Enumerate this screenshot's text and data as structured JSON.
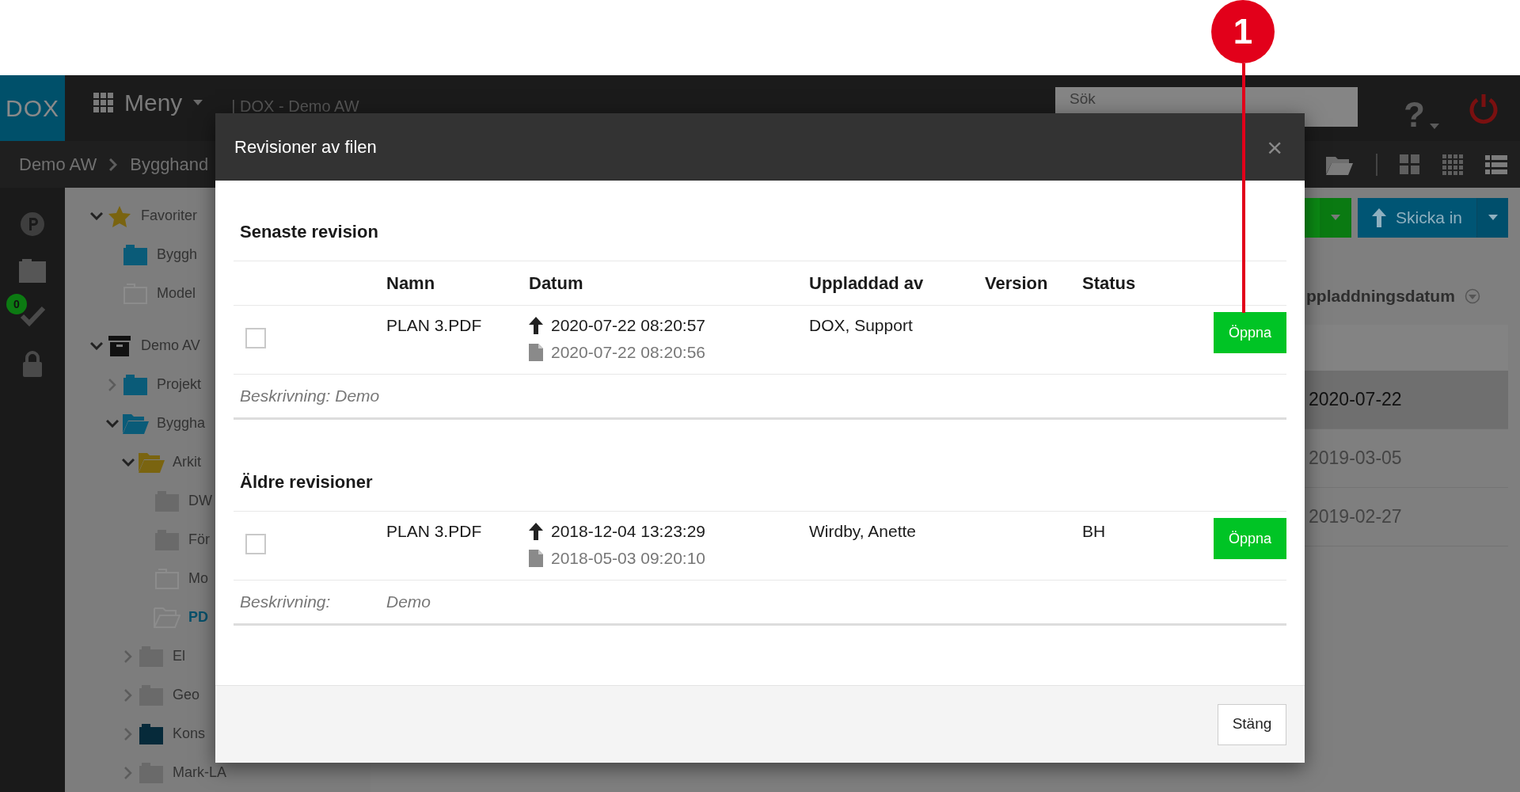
{
  "callout": {
    "number": "1"
  },
  "topbar": {
    "help": "?",
    "logo": "DOX",
    "menu": "Meny",
    "title": "| DOX - Demo AW",
    "search": {
      "placeholder": "Sök"
    }
  },
  "breadcrumb": [
    "Demo AW",
    "Bygghand"
  ],
  "rail": {
    "badge": "0"
  },
  "tree": [
    {
      "label": "Favoriter",
      "kind": "star",
      "color": "#7a6410",
      "expanded": true,
      "selected": false,
      "children": [
        {
          "label": "Byggh",
          "kind": "folder",
          "color": "#0a5b78",
          "selected": false
        },
        {
          "label": "Model",
          "kind": "folder-outline",
          "color": "#8c8c8c",
          "selected": false
        }
      ]
    },
    {
      "label": "Demo AV",
      "kind": "archive",
      "color": "#111111",
      "expanded": true,
      "selected": false,
      "children": [
        {
          "label": "Projekt",
          "kind": "folder",
          "color": "#0a5b78",
          "expanded": false,
          "selected": false
        },
        {
          "label": "Byggha",
          "kind": "folder-open",
          "color": "#0a5b78",
          "expanded": true,
          "selected": false,
          "children": [
            {
              "label": "Arkit",
              "kind": "folder-open",
              "color": "#7a6410",
              "expanded": true,
              "selected": false,
              "children": [
                {
                  "label": "DW",
                  "kind": "folder",
                  "color": "#6a6a6a",
                  "selected": false
                },
                {
                  "label": "För",
                  "kind": "folder",
                  "color": "#6a6a6a",
                  "selected": false
                },
                {
                  "label": "Mo",
                  "kind": "folder-outline",
                  "color": "#8c8c8c",
                  "selected": false
                },
                {
                  "label": "PD",
                  "kind": "folder-open-outline",
                  "color": "#8c8c8c",
                  "selected": true
                }
              ]
            },
            {
              "label": "El",
              "kind": "folder",
              "color": "#6a6a6a",
              "expanded": false,
              "selected": false
            },
            {
              "label": "Geo",
              "kind": "folder",
              "color": "#6a6a6a",
              "expanded": false,
              "selected": false
            },
            {
              "label": "Kons",
              "kind": "folder",
              "color": "#062a3a",
              "expanded": false,
              "selected": false
            },
            {
              "label": "Mark-LA",
              "kind": "folder",
              "color": "#6a6a6a",
              "expanded": false,
              "selected": false
            }
          ]
        }
      ]
    }
  ],
  "actions": {
    "submit_button": "Skicka in"
  },
  "file_list": {
    "sort_column": "ppladdningsdatum",
    "rows": [
      {
        "date": "2020-07-22",
        "selected": true
      },
      {
        "date": "2019-03-05",
        "selected": false
      },
      {
        "date": "2019-02-27",
        "selected": false
      }
    ]
  },
  "modal": {
    "title": "Revisioner av filen",
    "sections": [
      {
        "heading": "Senaste revision",
        "columns": [
          "Namn",
          "Datum",
          "Uppladdad av",
          "Version",
          "Status"
        ],
        "rows": [
          {
            "checked": false,
            "name": "PLAN 3.PDF",
            "uploaded": "2020-07-22 08:20:57",
            "created": "2020-07-22 08:20:56",
            "uploaded_by": "DOX, Support",
            "open_button": "Öppna",
            "description": {
              "kind": "inline",
              "text": "Beskrivning: Demo"
            }
          }
        ]
      },
      {
        "heading": "Äldre revisioner",
        "rows": [
          {
            "checked": false,
            "name": "PLAN 3.PDF",
            "uploaded": "2018-12-04 13:23:29",
            "created": "2018-05-03 09:20:10",
            "uploaded_by": "Wirdby, Anette",
            "status": "BH",
            "open_button": "Öppna",
            "description": {
              "kind": "columns",
              "label": "Beskrivning:",
              "value": "Demo"
            }
          }
        ]
      }
    ],
    "close_icon": "×",
    "close_button": "Stäng"
  }
}
